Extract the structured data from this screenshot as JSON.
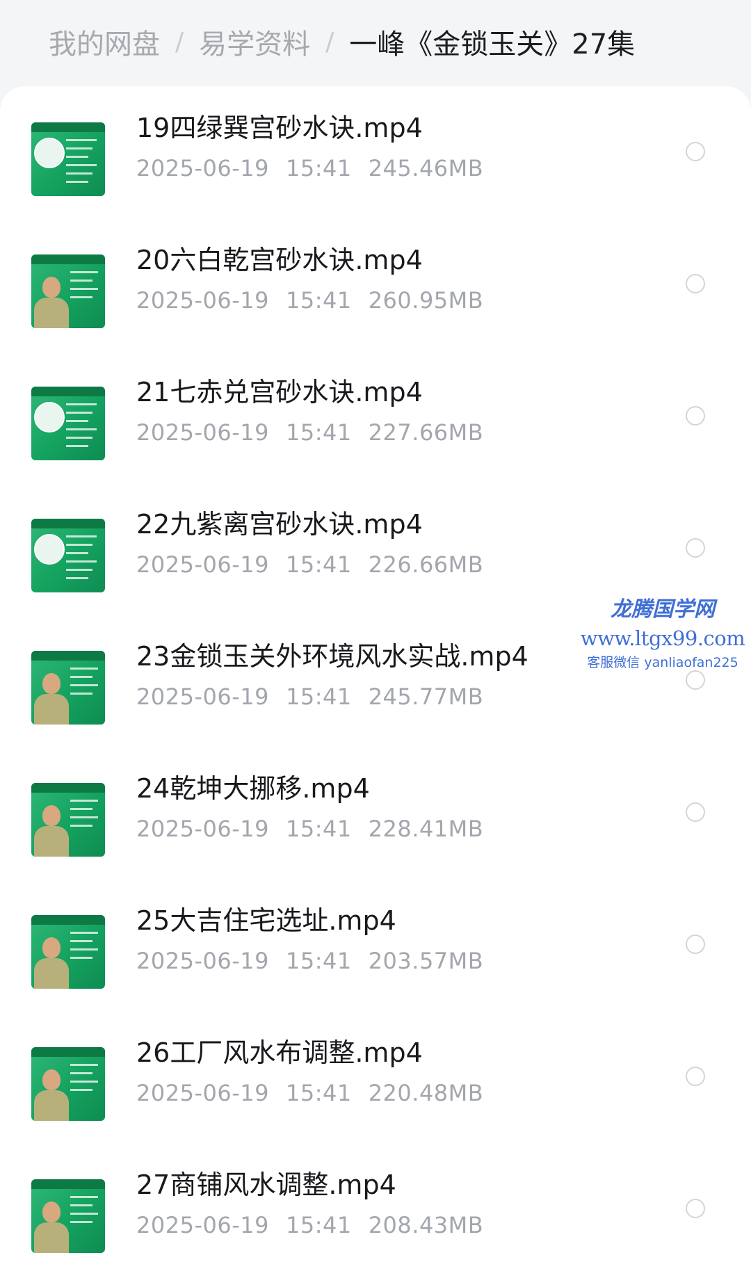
{
  "breadcrumb": {
    "items": [
      "我的网盘",
      "易学资料"
    ],
    "separator": "/",
    "current": "一峰《金锁玉关》27集"
  },
  "files": [
    {
      "name": "19四绿巽宫砂水诀.mp4",
      "date": "2025-06-19",
      "time": "15:41",
      "size": "245.46MB",
      "thumb": "board"
    },
    {
      "name": "20六白乾宫砂水诀.mp4",
      "date": "2025-06-19",
      "time": "15:41",
      "size": "260.95MB",
      "thumb": "person"
    },
    {
      "name": "21七赤兑宫砂水诀.mp4",
      "date": "2025-06-19",
      "time": "15:41",
      "size": "227.66MB",
      "thumb": "board"
    },
    {
      "name": "22九紫离宫砂水诀.mp4",
      "date": "2025-06-19",
      "time": "15:41",
      "size": "226.66MB",
      "thumb": "board"
    },
    {
      "name": "23金锁玉关外环境风水实战.mp4",
      "date": "2025-06-19",
      "time": "15:41",
      "size": "245.77MB",
      "thumb": "person"
    },
    {
      "name": "24乾坤大挪移.mp4",
      "date": "2025-06-19",
      "time": "15:41",
      "size": "228.41MB",
      "thumb": "person"
    },
    {
      "name": "25大吉住宅选址.mp4",
      "date": "2025-06-19",
      "time": "15:41",
      "size": "203.57MB",
      "thumb": "person"
    },
    {
      "name": "26工厂风水布调整.mp4",
      "date": "2025-06-19",
      "time": "15:41",
      "size": "220.48MB",
      "thumb": "person"
    },
    {
      "name": "27商铺风水调整.mp4",
      "date": "2025-06-19",
      "time": "15:41",
      "size": "208.43MB",
      "thumb": "person"
    }
  ],
  "watermark": {
    "brand": "龙腾国学网",
    "url": "www.ltgx99.com",
    "contact": "客服微信 yanliaofan225"
  }
}
